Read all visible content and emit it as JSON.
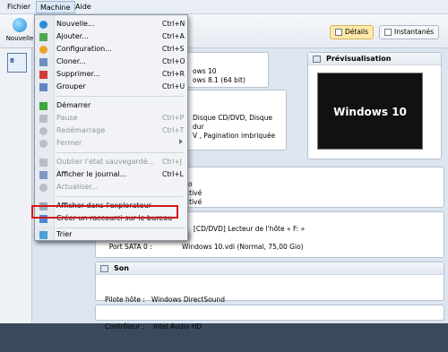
{
  "menubar": {
    "items": [
      "Fichier",
      "Machine",
      "Aide"
    ]
  },
  "toolbar": {
    "new_label": "Nouvelle",
    "details_label": "Détails",
    "snapshots_label": "Instantanés"
  },
  "vm": {
    "thumb_label": "8"
  },
  "sections": {
    "general_title": "",
    "general_lines": [
      "ows 10",
      "ows 8.1 (64 bit)"
    ],
    "system_lines": [
      "Disque CD/DVD, Disque dur",
      "V , Pagination imbriquée"
    ],
    "display_lines": [
      "to",
      "ctivé",
      "ctivé"
    ],
    "preview_title": "Prévisualisation",
    "preview_text": "Windows 10",
    "storage_lines": [
      "Maître secondaire IDE :     [CD/DVD] Lecteur de l'hôte « F: »",
      "Contrôleur : SATA",
      "  Port SATA 0 :              Windows 10.vdi (Normal, 75,00 Gio)"
    ],
    "audio_title": "Son",
    "audio_lines": [
      "Pilote hôte :   Windows DirectSound",
      "Contrôleur :    Intel Audio HD"
    ]
  },
  "menu": {
    "items": [
      {
        "label": "Nouvelle...",
        "shortcut": "Ctrl+N",
        "icon": "new-icon",
        "disabled": false
      },
      {
        "label": "Ajouter...",
        "shortcut": "Ctrl+A",
        "icon": "add-icon",
        "disabled": false
      },
      {
        "label": "Configuration...",
        "shortcut": "Ctrl+S",
        "icon": "settings-icon",
        "disabled": false
      },
      {
        "label": "Cloner...",
        "shortcut": "Ctrl+O",
        "icon": "clone-icon",
        "disabled": false
      },
      {
        "label": "Supprimer...",
        "shortcut": "Ctrl+R",
        "icon": "delete-icon",
        "disabled": false
      },
      {
        "label": "Grouper",
        "shortcut": "Ctrl+U",
        "icon": "group-icon",
        "disabled": false
      },
      {
        "label": "Démarrer",
        "shortcut": "",
        "icon": "start-icon",
        "disabled": false
      },
      {
        "label": "Pause",
        "shortcut": "Ctrl+P",
        "icon": "pause-icon",
        "disabled": true
      },
      {
        "label": "Redémarrage",
        "shortcut": "Ctrl+T",
        "icon": "reset-icon",
        "disabled": true
      },
      {
        "label": "Fermer",
        "shortcut": "",
        "icon": "close-icon",
        "disabled": true
      },
      {
        "label": "Oublier l'état sauvegardé...",
        "shortcut": "Ctrl+J",
        "icon": "discard-icon",
        "disabled": true
      },
      {
        "label": "Afficher le journal...",
        "shortcut": "Ctrl+L",
        "icon": "log-icon",
        "disabled": false
      },
      {
        "label": "Actualiser...",
        "shortcut": "",
        "icon": "refresh-icon",
        "disabled": true
      },
      {
        "label": "Afficher dans l'explorateur",
        "shortcut": "",
        "icon": "explorer-icon",
        "disabled": false
      },
      {
        "label": "Créer un raccourci sur le bureau",
        "shortcut": "",
        "icon": "shortcut-icon",
        "disabled": false
      },
      {
        "label": "Trier",
        "shortcut": "",
        "icon": "sort-icon",
        "disabled": false
      }
    ]
  },
  "colors": {
    "accent": "#d11919",
    "selected": "#ffe9a8"
  }
}
